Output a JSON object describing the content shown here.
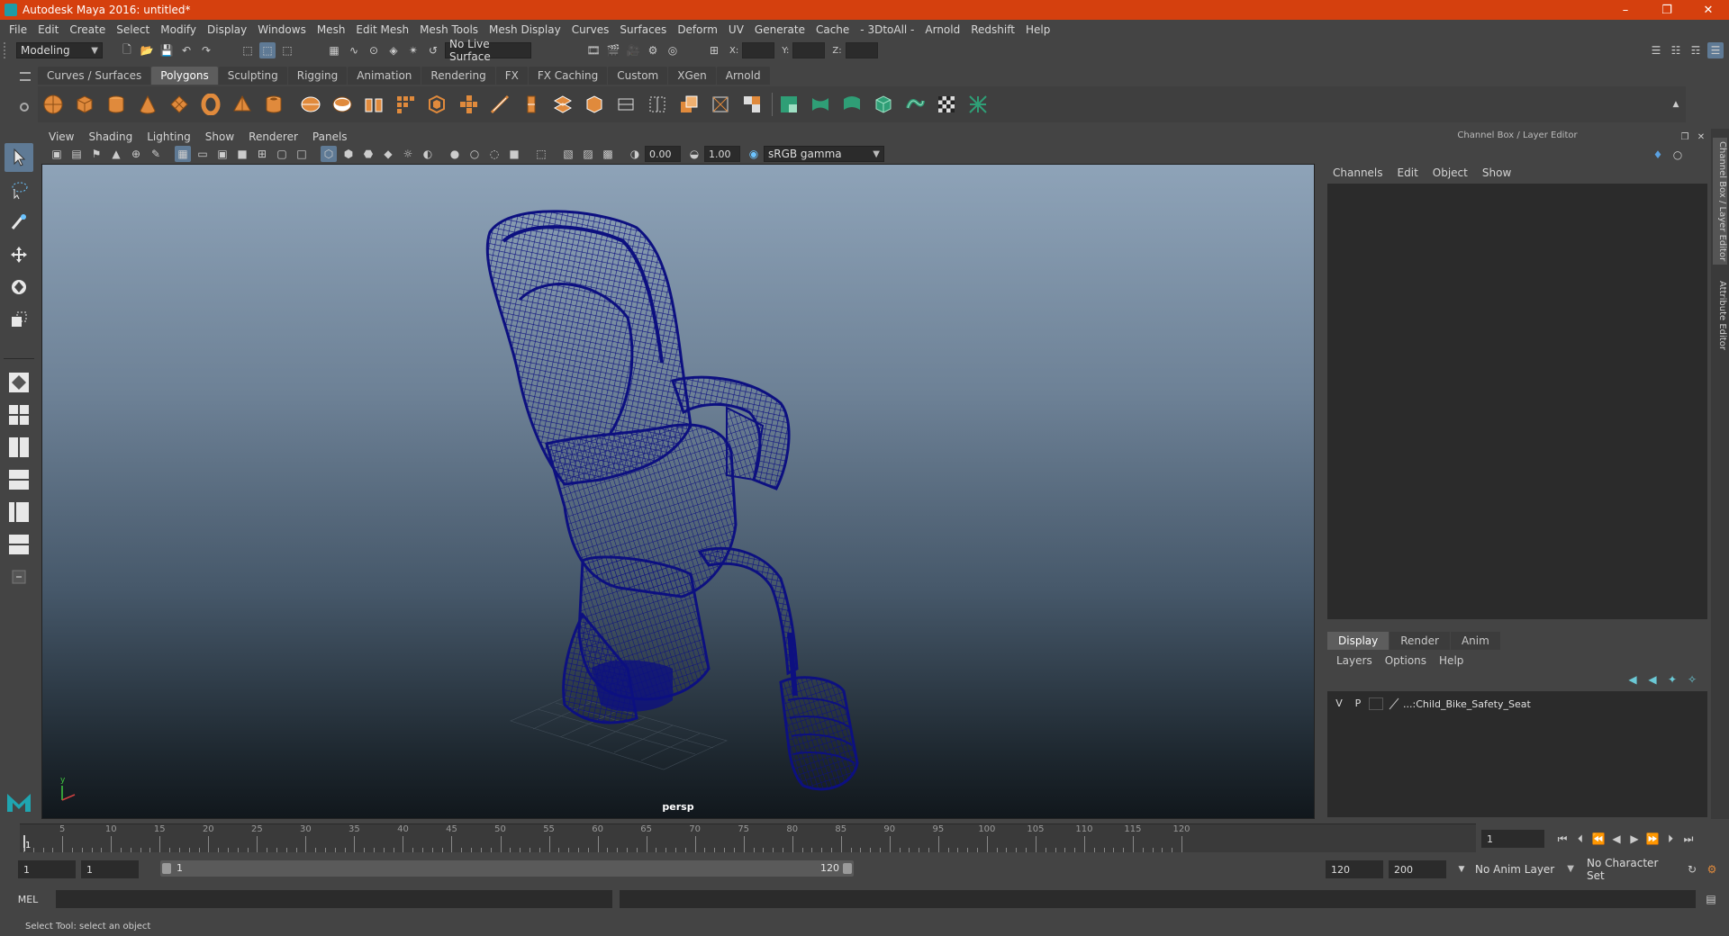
{
  "window": {
    "title": "Autodesk Maya 2016: untitled*"
  },
  "menubar": [
    "File",
    "Edit",
    "Create",
    "Select",
    "Modify",
    "Display",
    "Windows",
    "Mesh",
    "Edit Mesh",
    "Mesh Tools",
    "Mesh Display",
    "Curves",
    "Surfaces",
    "Deform",
    "UV",
    "Generate",
    "Cache",
    "- 3DtoAll -",
    "Arnold",
    "Redshift",
    "Help"
  ],
  "status_line": {
    "menu_set": "Modeling",
    "live_surface": "No Live Surface",
    "x_label": "X:",
    "y_label": "Y:",
    "z_label": "Z:"
  },
  "shelf": {
    "tabs": [
      "Curves / Surfaces",
      "Polygons",
      "Sculpting",
      "Rigging",
      "Animation",
      "Rendering",
      "FX",
      "FX Caching",
      "Custom",
      "XGen",
      "Arnold"
    ],
    "active_tab": "Polygons"
  },
  "viewport": {
    "menu": [
      "View",
      "Shading",
      "Lighting",
      "Show",
      "Renderer",
      "Panels"
    ],
    "exposure": "0.00",
    "gamma": "1.00",
    "color_space": "sRGB gamma",
    "camera": "persp",
    "axis_y": "y",
    "mesh_color": "#0d1080"
  },
  "channel_box": {
    "title": "Channel Box / Layer Editor",
    "menu": [
      "Channels",
      "Edit",
      "Object",
      "Show"
    ]
  },
  "layer_editor": {
    "tabs": [
      "Display",
      "Render",
      "Anim"
    ],
    "active_tab": "Display",
    "menu": [
      "Layers",
      "Options",
      "Help"
    ],
    "layer": {
      "v": "V",
      "p": "P",
      "name": "...:Child_Bike_Safety_Seat"
    }
  },
  "side_tabs": [
    "Channel Box / Layer Editor",
    "Attribute Editor"
  ],
  "time_slider": {
    "ticks": [
      "5",
      "10",
      "15",
      "20",
      "25",
      "30",
      "35",
      "40",
      "45",
      "50",
      "55",
      "60",
      "65",
      "70",
      "75",
      "80",
      "85",
      "90",
      "95",
      "100",
      "105",
      "110",
      "115",
      "120"
    ],
    "current_frame_marker": "1",
    "current_frame_field": "1"
  },
  "range_slider": {
    "start": "1",
    "playback_start": "1",
    "range_start_label": "1",
    "range_end_label": "120",
    "playback_end": "120",
    "end": "200",
    "anim_layer": "No Anim Layer",
    "character_set": "No Character Set"
  },
  "command_line": {
    "label": "MEL"
  },
  "help_line": {
    "text": "Select Tool: select an object"
  }
}
